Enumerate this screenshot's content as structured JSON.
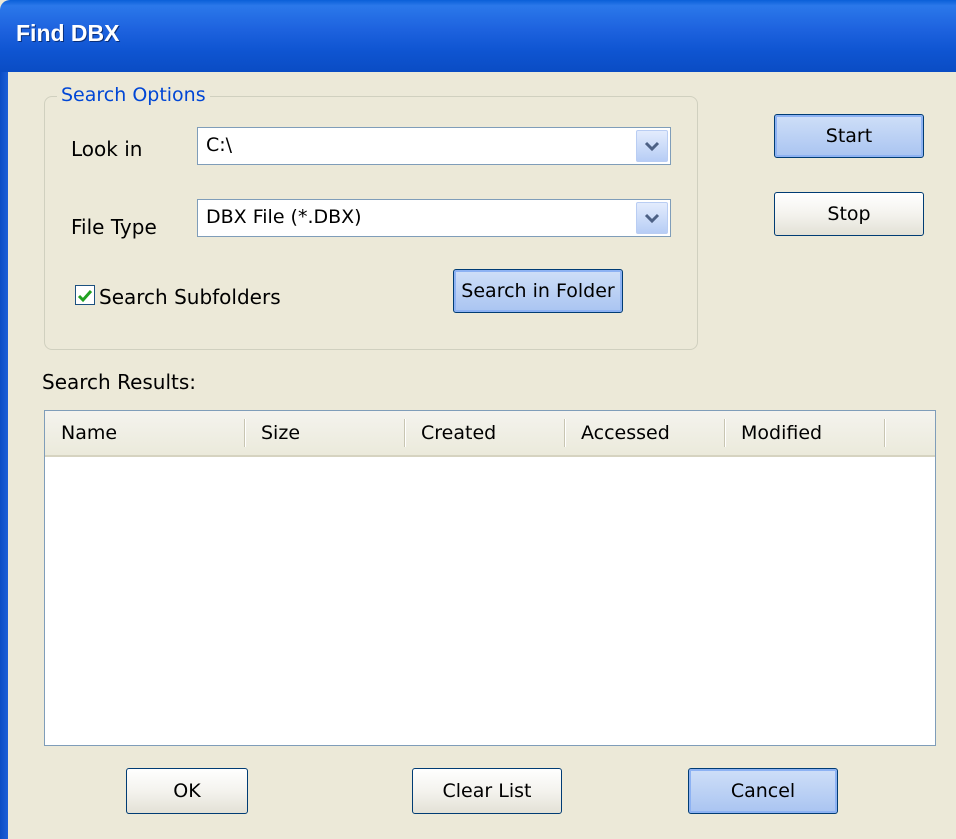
{
  "window": {
    "title": "Find DBX"
  },
  "search_options": {
    "legend": "Search Options",
    "look_in": {
      "label": "Look in",
      "value": "C:\\"
    },
    "file_type": {
      "label": "File Type",
      "value": "DBX File (*.DBX)"
    },
    "subfolders": {
      "label": "Search Subfolders",
      "checked": true
    },
    "search_in_folder_label": "Search in Folder"
  },
  "side_buttons": {
    "start": "Start",
    "stop": "Stop"
  },
  "results": {
    "label": "Search Results:",
    "columns": [
      "Name",
      "Size",
      "Created",
      "Accessed",
      "Modified"
    ],
    "rows": []
  },
  "footer": {
    "ok": "OK",
    "clear_list": "Clear List",
    "cancel": "Cancel"
  }
}
